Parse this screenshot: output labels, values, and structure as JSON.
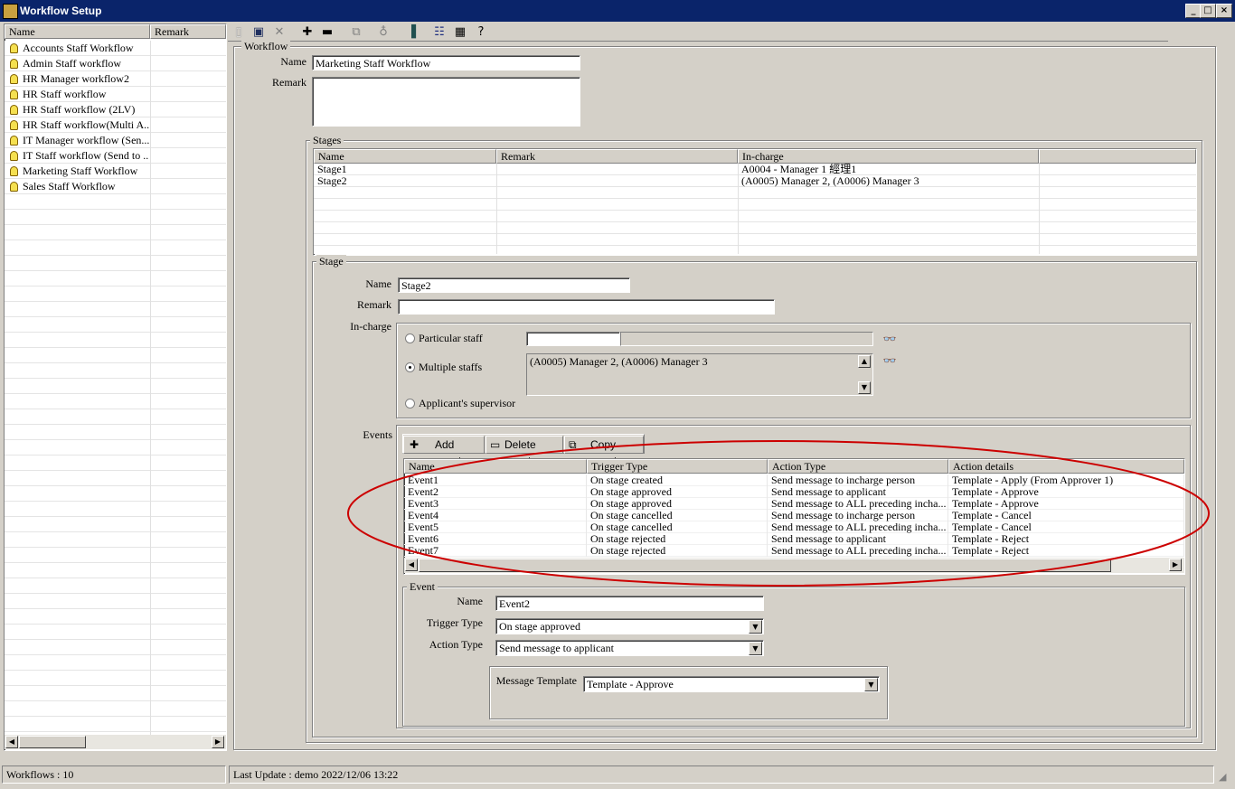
{
  "window": {
    "title": "Workflow Setup",
    "minimize": "_",
    "maximize": "□",
    "close": "×"
  },
  "list": {
    "columns": [
      "Name",
      "Remark"
    ],
    "items": [
      "Accounts Staff Workflow",
      "Admin Staff workflow",
      "HR Manager workflow2",
      "HR Staff workflow",
      "HR Staff workflow (2LV)",
      "HR Staff workflow(Multi A...",
      "IT Manager workflow (Sen...",
      "IT Staff workflow (Send to ...",
      "Marketing Staff Workflow",
      "Sales Staff Workflow"
    ]
  },
  "toolbar": {
    "icons": [
      "new-icon",
      "save-icon",
      "delete-icon",
      "add-icon",
      "remove-icon",
      "copy-icon",
      "bulb-icon",
      "exit-icon",
      "list-view-icon",
      "grid-view-icon",
      "help-icon"
    ]
  },
  "workflow": {
    "group_title": "Workflow",
    "name_label": "Name",
    "name_value": "Marketing Staff Workflow",
    "remark_label": "Remark",
    "remark_value": ""
  },
  "stages": {
    "group_title": "Stages",
    "columns": [
      "Name",
      "Remark",
      "In-charge"
    ],
    "rows": [
      {
        "name": "Stage1",
        "remark": "",
        "incharge": "A0004 - Manager 1 經理1"
      },
      {
        "name": "Stage2",
        "remark": "",
        "incharge": "(A0005) Manager 2, (A0006) Manager 3"
      }
    ]
  },
  "stage": {
    "group_title": "Stage",
    "name_label": "Name",
    "name_value": "Stage2",
    "remark_label": "Remark",
    "remark_value": "",
    "incharge_label": "In-charge",
    "opt_particular": "Particular staff",
    "opt_multiple": "Multiple staffs",
    "opt_supervisor": "Applicant's supervisor",
    "multiple_value": "(A0005) Manager 2, (A0006) Manager 3",
    "events_label": "Events"
  },
  "events": {
    "add": "Add event",
    "delete": "Delete event",
    "copy": "Copy event",
    "columns": [
      "Name",
      "Trigger Type",
      "Action Type",
      "Action details"
    ],
    "rows": [
      {
        "name": "Event1",
        "trigger": "On stage created",
        "action": "Send message to incharge person",
        "details": "Template - Apply (From Approver 1)"
      },
      {
        "name": "Event2",
        "trigger": "On stage approved",
        "action": "Send message to applicant",
        "details": "Template - Approve"
      },
      {
        "name": "Event3",
        "trigger": "On stage approved",
        "action": "Send message to ALL preceding incha...",
        "details": "Template - Approve"
      },
      {
        "name": "Event4",
        "trigger": "On stage cancelled",
        "action": "Send message to incharge person",
        "details": "Template - Cancel"
      },
      {
        "name": "Event5",
        "trigger": "On stage cancelled",
        "action": "Send message to ALL preceding incha...",
        "details": "Template - Cancel"
      },
      {
        "name": "Event6",
        "trigger": "On stage rejected",
        "action": "Send message to applicant",
        "details": "Template - Reject"
      },
      {
        "name": "Event7",
        "trigger": "On stage rejected",
        "action": "Send message to ALL preceding incha...",
        "details": "Template - Reject"
      }
    ]
  },
  "event": {
    "group_title": "Event",
    "name_label": "Name",
    "name_value": "Event2",
    "trigger_label": "Trigger Type",
    "trigger_value": "On stage approved",
    "action_label": "Action Type",
    "action_value": "Send message to applicant",
    "template_label": "Message Template",
    "template_value": "Template - Approve"
  },
  "status": {
    "left": "Workflows : 10",
    "right": "Last Update : demo 2022/12/06 13:22"
  },
  "colors": {
    "titlebar": "#0a246a",
    "face": "#d4d0c8",
    "annotation": "#cc0000"
  }
}
